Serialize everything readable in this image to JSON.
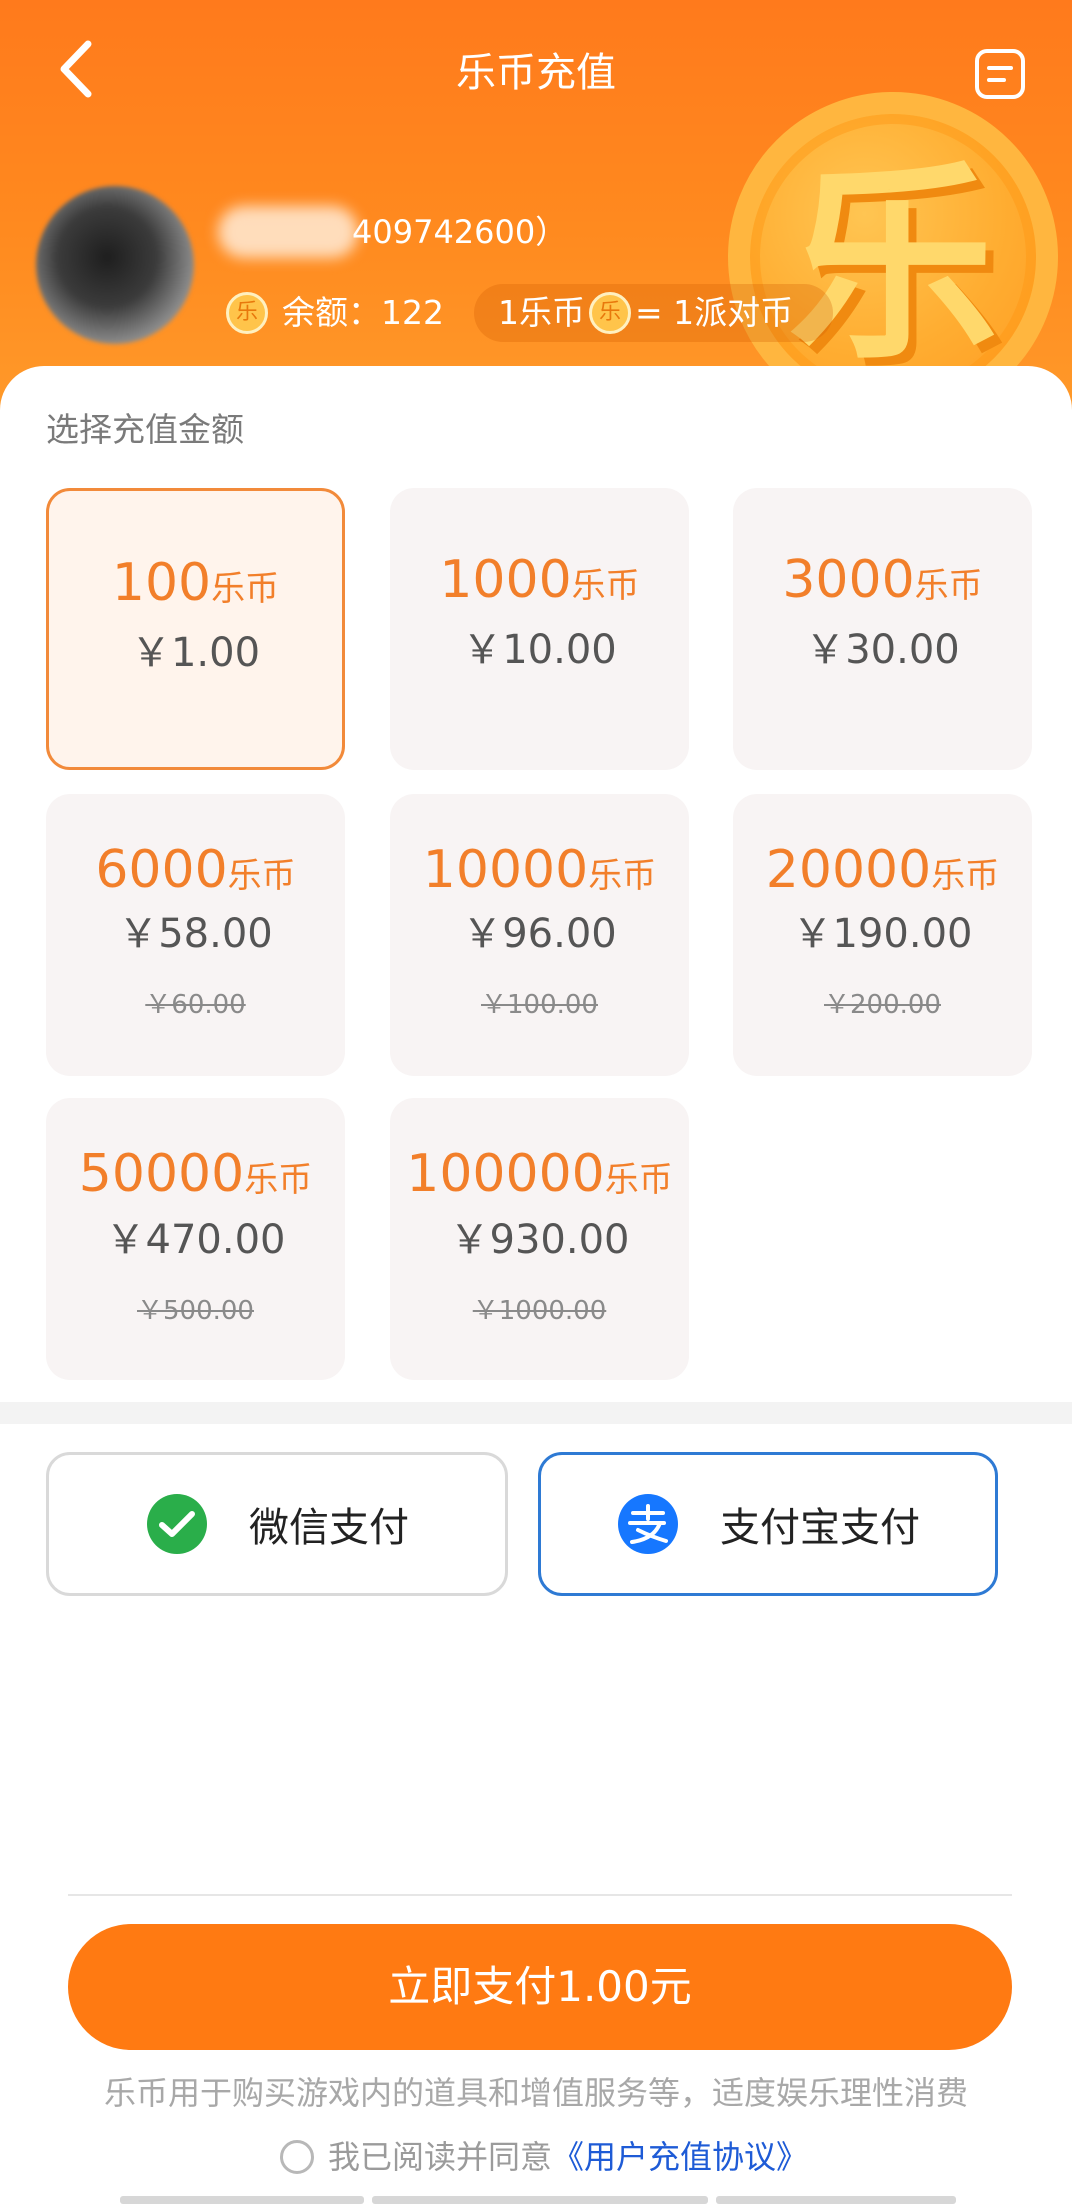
{
  "header": {
    "title": "乐币充值",
    "user_id": "409742600）",
    "balance_label": "余额：",
    "balance_value": "122",
    "rate_left": "1乐币",
    "rate_right": "= 1派对币",
    "coin_glyph": "乐"
  },
  "section_label": "选择充值金额",
  "packages": [
    {
      "coins": "100",
      "unit": "乐币",
      "price": "￥1.00",
      "original": "",
      "selected": true
    },
    {
      "coins": "1000",
      "unit": "乐币",
      "price": "￥10.00",
      "original": ""
    },
    {
      "coins": "3000",
      "unit": "乐币",
      "price": "￥30.00",
      "original": ""
    },
    {
      "coins": "6000",
      "unit": "乐币",
      "price": "￥58.00",
      "original": "￥60.00"
    },
    {
      "coins": "10000",
      "unit": "乐币",
      "price": "￥96.00",
      "original": "￥100.00"
    },
    {
      "coins": "20000",
      "unit": "乐币",
      "price": "￥190.00",
      "original": "￥200.00"
    },
    {
      "coins": "50000",
      "unit": "乐币",
      "price": "￥470.00",
      "original": "￥500.00"
    },
    {
      "coins": "100000",
      "unit": "乐币",
      "price": "￥930.00",
      "original": "￥1000.00"
    }
  ],
  "payment": {
    "wechat_label": "微信支付",
    "alipay_label": "支付宝支付",
    "selected": "alipay"
  },
  "pay_now_label": "立即支付1.00元",
  "notice": "乐币用于购买游戏内的道具和增值服务等，适度娱乐理性消费",
  "agreement": {
    "prefix": "我已阅读并同意",
    "link": "《用户充值协议》"
  },
  "colors": {
    "accent": "#ff7a12",
    "coin_text": "#f27f2a",
    "alipay_blue": "#2e7ad4",
    "wechat_green": "#2aae4a"
  },
  "icons": {
    "back": "chevron-left-icon",
    "menu": "order-list-icon",
    "wechat": "wechat-pay-icon",
    "alipay": "alipay-icon"
  }
}
